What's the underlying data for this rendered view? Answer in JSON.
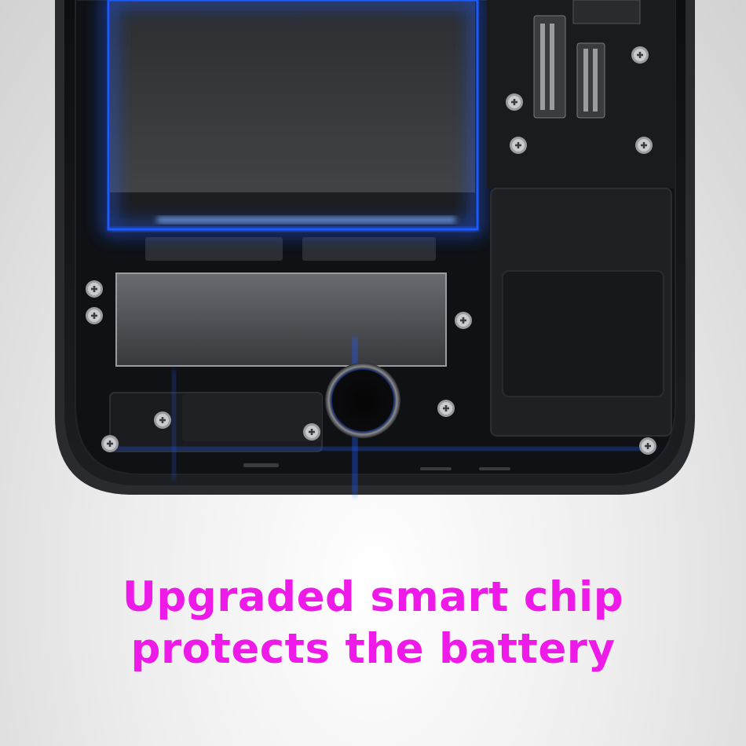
{
  "caption": {
    "line1": "Upgraded smart chip",
    "line2": "protects the battery"
  },
  "colors": {
    "caption_text": "#ee1ae8",
    "glow": "#1e5bff",
    "phone_body": "#141518",
    "background": "#e6e6e6"
  },
  "icons": [
    "phone-internals-illustration",
    "home-button-icon",
    "screw-icon",
    "battery-icon",
    "chip-shield-icon"
  ]
}
